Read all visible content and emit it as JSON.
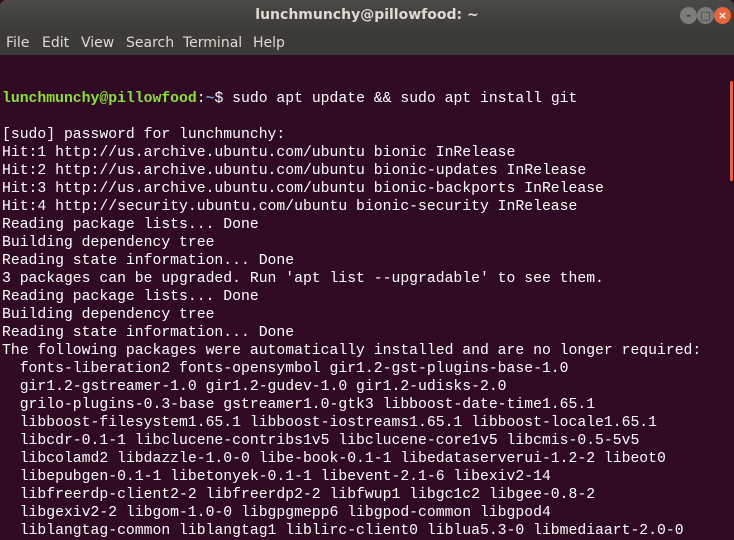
{
  "window": {
    "title": "lunchmunchy@pillowfood: ~",
    "minimize_icon": "minimize-icon",
    "maximize_icon": "maximize-icon",
    "close_icon": "close-icon"
  },
  "menubar": {
    "items": [
      "File",
      "Edit",
      "View",
      "Search",
      "Terminal",
      "Help"
    ]
  },
  "terminal": {
    "prompt": {
      "user_host": "lunchmunchy@pillowfood",
      "colon": ":",
      "path": "~",
      "symbol": "$",
      "command": " sudo apt update && sudo apt install git"
    },
    "lines": [
      "[sudo] password for lunchmunchy:",
      "Hit:1 http://us.archive.ubuntu.com/ubuntu bionic InRelease",
      "Hit:2 http://us.archive.ubuntu.com/ubuntu bionic-updates InRelease",
      "Hit:3 http://us.archive.ubuntu.com/ubuntu bionic-backports InRelease",
      "Hit:4 http://security.ubuntu.com/ubuntu bionic-security InRelease",
      "Reading package lists... Done",
      "Building dependency tree",
      "Reading state information... Done",
      "3 packages can be upgraded. Run 'apt list --upgradable' to see them.",
      "Reading package lists... Done",
      "Building dependency tree",
      "Reading state information... Done",
      "The following packages were automatically installed and are no longer required:",
      "  fonts-liberation2 fonts-opensymbol gir1.2-gst-plugins-base-1.0",
      "  gir1.2-gstreamer-1.0 gir1.2-gudev-1.0 gir1.2-udisks-2.0",
      "  grilo-plugins-0.3-base gstreamer1.0-gtk3 libboost-date-time1.65.1",
      "  libboost-filesystem1.65.1 libboost-iostreams1.65.1 libboost-locale1.65.1",
      "  libcdr-0.1-1 libclucene-contribs1v5 libclucene-core1v5 libcmis-0.5-5v5",
      "  libcolamd2 libdazzle-1.0-0 libe-book-0.1-1 libedataserverui-1.2-2 libeot0",
      "  libepubgen-0.1-1 libetonyek-0.1-1 libevent-2.1-6 libexiv2-14",
      "  libfreerdp-client2-2 libfreerdp2-2 libfwup1 libgc1c2 libgee-0.8-2",
      "  libgexiv2-2 libgom-1.0-0 libgpgmepp6 libgpod-common libgpod4",
      "  liblangtag-common liblangtag1 liblirc-client0 liblua5.3-0 libmediaart-2.0-0"
    ]
  },
  "colors": {
    "background": "#300a24",
    "prompt_user": "#8ae234",
    "prompt_path": "#729fcf",
    "accent": "#e9643a"
  }
}
